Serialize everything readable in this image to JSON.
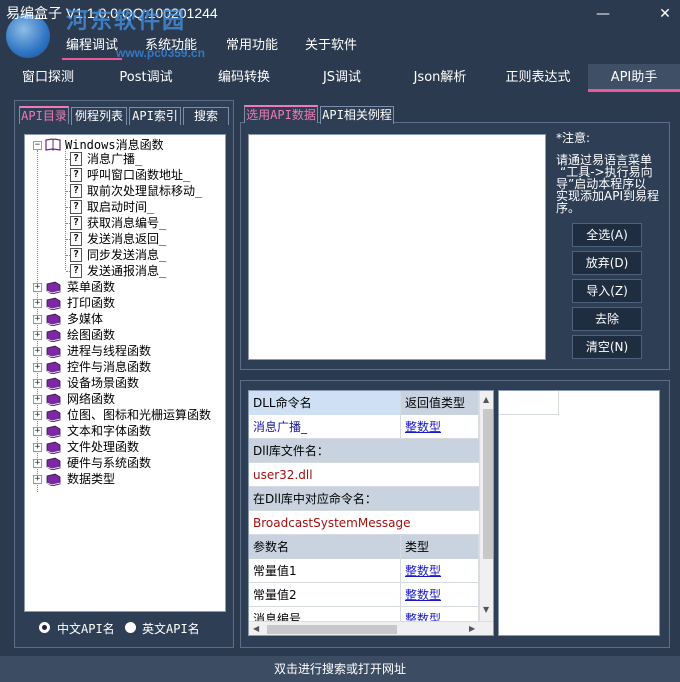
{
  "title": "易编盒子 V1.1.0.0 QQ:100201244",
  "watermark": {
    "text": "河东软件园",
    "url": "www.pc0359.cn"
  },
  "window": {
    "minimize": "—",
    "close": "✕"
  },
  "menu": [
    "编程调试",
    "系统功能",
    "常用功能",
    "关于软件"
  ],
  "tabs": [
    "窗口探测",
    "Post调试",
    "编码转换",
    "JS调试",
    "Json解析",
    "正则表达式",
    "API助手"
  ],
  "left_tabs": [
    "API目录",
    "例程列表",
    "API索引",
    "搜索"
  ],
  "tree": {
    "root": "Windows消息函数",
    "children": [
      "消息广播_",
      "呼叫窗口函数地址_",
      "取前次处理鼠标移动_",
      "取启动时间_",
      "获取消息编号_",
      "发送消息返回_",
      "同步发送消息_",
      "发送通报消息_"
    ],
    "groups": [
      "菜单函数",
      "打印函数",
      "多媒体",
      "绘图函数",
      "进程与线程函数",
      "控件与消息函数",
      "设备场景函数",
      "网络函数",
      "位图、图标和光栅运算函数",
      "文本和字体函数",
      "文件处理函数",
      "硬件与系统函数",
      "数据类型"
    ]
  },
  "radio": {
    "cn": "中文API名",
    "en": "英文API名"
  },
  "right_tabs": [
    "选用API数据",
    "API相关例程"
  ],
  "note": {
    "title": "*注意:",
    "lines": [
      "请通过易语言菜单",
      "“工具->执行易向",
      "导”启动本程序以",
      "实现添加API到易程",
      "序。"
    ]
  },
  "buttons": [
    "全选(A)",
    "放弃(D)",
    "导入(Z)",
    "去除",
    "清空(N)"
  ],
  "grid": {
    "header1": [
      "DLL命令名",
      "返回值类型"
    ],
    "row1": [
      "消息广播_",
      "整数型"
    ],
    "dll_label": "Dll库文件名：",
    "dll_value": "user32.dll",
    "cmd_label": "在Dll库中对应命令名：",
    "cmd_value": "BroadcastSystemMessage",
    "header2": [
      "参数名",
      "类型"
    ],
    "params": [
      [
        "常量值1",
        "整数型"
      ],
      [
        "常量值2",
        "整数型"
      ],
      [
        "消息编号",
        "整数型"
      ]
    ]
  },
  "status": "双击进行搜索或打开网址"
}
